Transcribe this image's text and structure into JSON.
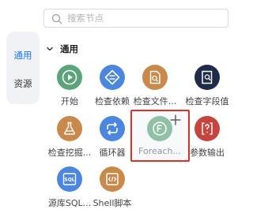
{
  "search": {
    "placeholder": "搜索节点"
  },
  "tabs": [
    {
      "label": "通用",
      "active": true
    },
    {
      "label": "资源",
      "active": false
    }
  ],
  "section": {
    "title": "通用",
    "expanded": true
  },
  "nodes": [
    {
      "label": "开始",
      "icon": "play-icon",
      "color": "#5aa47a"
    },
    {
      "label": "检查依赖",
      "icon": "link-check-icon",
      "color": "#4b86e0"
    },
    {
      "label": "检查文件...",
      "icon": "file-check-icon",
      "color": "#c9894a"
    },
    {
      "label": "检查字段值",
      "icon": "field-check-icon",
      "color": "#1f2b4a"
    },
    {
      "label": "检查挖掘...",
      "icon": "flask-icon",
      "color": "#c9894a"
    },
    {
      "label": "循环器",
      "icon": "loop-icon",
      "color": "#4b86e0"
    },
    {
      "label": "Foreach...",
      "icon": "foreach-icon",
      "color": "#5aa47a"
    },
    {
      "label": "参数输出",
      "icon": "param-output-icon",
      "color": "#c6443c"
    },
    {
      "label": "源库SQL...",
      "icon": "sql-icon",
      "color": "#4b86e0"
    },
    {
      "label": "Shell脚本",
      "icon": "shell-script-icon",
      "color": "#c9894a"
    }
  ],
  "drag": {
    "plus_icon": "plus-icon",
    "highlight_color": "#e0302a"
  }
}
